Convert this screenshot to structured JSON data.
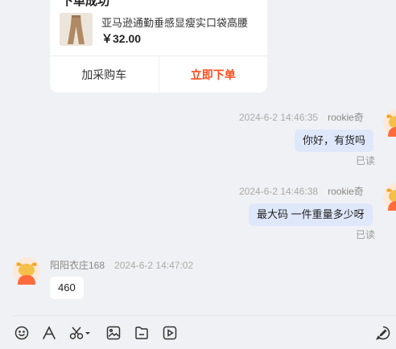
{
  "product_card": {
    "title": "下单成功",
    "name": "亚马逊通勤垂感显瘦实口袋高腰",
    "price": "￥32.00",
    "add_cart_label": "加采购车",
    "order_label": "立即下单"
  },
  "messages": [
    {
      "time": "2024-6-2 14:46:35",
      "sender": "rookie奇",
      "text": "你好，有货吗",
      "status": "已读"
    },
    {
      "time": "2024-6-2 14:46:38",
      "sender": "rookie奇",
      "text": "最大码 一件重量多少呀",
      "status": "已读"
    },
    {
      "time": "2024-6-2 14:47:02",
      "sender": "阳阳衣庄168",
      "text": "460"
    }
  ],
  "toolbar": {
    "icons": [
      "emoji-icon",
      "font-icon",
      "scissors-icon",
      "image-icon",
      "file-icon",
      "video-icon",
      "quick-reply-icon"
    ]
  },
  "colors": {
    "accent": "#ff4a1a",
    "bubble_out": "#dfe8fb",
    "background": "#f0f1f5"
  }
}
